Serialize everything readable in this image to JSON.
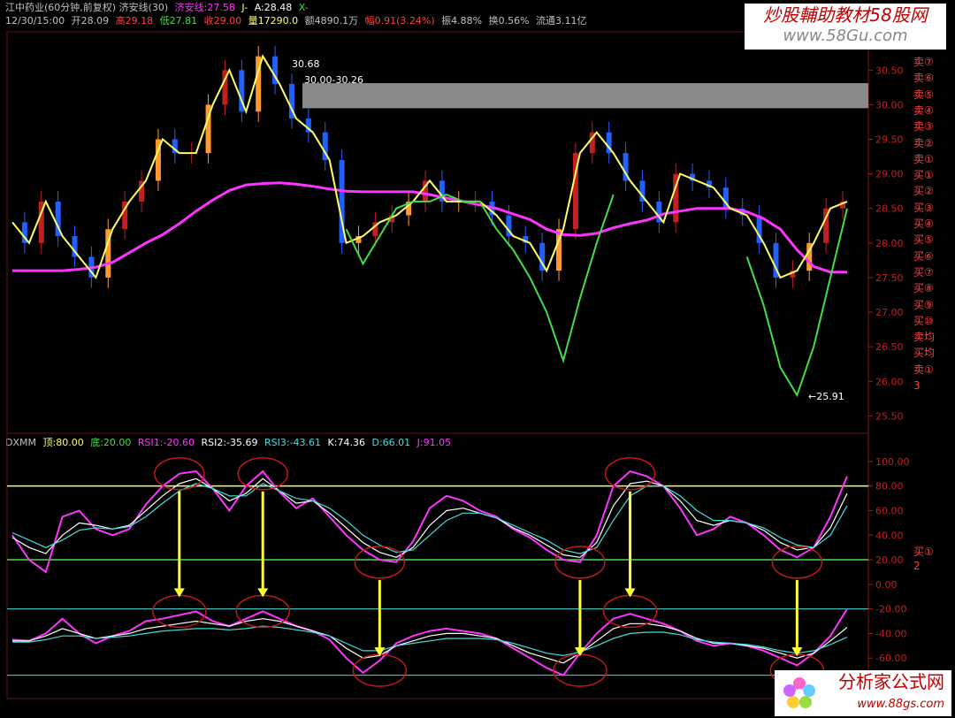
{
  "header": {
    "line1": {
      "title": "江中药业(60分钟,前复权) 济安线(30)",
      "jian_label": "济安线:27.58",
      "j_label": "J-",
      "a_label": "A:28.48",
      "x_label": "X-"
    },
    "line2": {
      "time": "12/30/15:00",
      "open": "开28.09",
      "high": "高29.18",
      "low": "低27.81",
      "close": "收29.00",
      "vol": "量17290.0",
      "amount": "额4890.1万",
      "change": "幅0.91(3.24%)",
      "amp": "振4.88%",
      "turnover": "换0.56%",
      "float": "流通3.11亿"
    }
  },
  "indicator_header": {
    "name": "DXMM",
    "top": "顶:80.00",
    "bottom": "底:20.00",
    "rsi1": "RSI1:-20.60",
    "rsi2": "RSI2:-35.69",
    "rsi3": "RSI3:-43.61",
    "k": "K:74.36",
    "d": "D:66.01",
    "j": "J:91.05"
  },
  "annotations": {
    "high_label": "30.68",
    "zone_label": "30.00-30.26",
    "low_label": "25.91"
  },
  "watermark_top": {
    "title": "炒股輔助教材58股网",
    "url": "www.58Gu.com"
  },
  "watermark_bottom": {
    "title": "分析家公式网",
    "url": "www.88gs.com"
  },
  "right_signals": [
    "卖⑦",
    "卖⑥",
    "卖⑤",
    "卖④",
    "卖③",
    "卖②",
    "卖①",
    "买①",
    "买②",
    "买③",
    "买④",
    "买⑤",
    "买⑥",
    "买⑦",
    "买⑧",
    "买⑨",
    "买⑩",
    "卖均",
    "买均",
    "卖①",
    "3"
  ],
  "right_signals_lower": [
    "买①",
    "2"
  ],
  "colors": {
    "background": "#000000",
    "yellow": "#ffff66",
    "magenta": "#ff33ff",
    "cyan": "#44dddd",
    "green": "#44dd44",
    "red": "#ff2020",
    "up": "#c02020",
    "down": "#2060ff"
  },
  "chart_data": [
    {
      "type": "line",
      "title": "江中药业(60分钟,前复权)",
      "ylim": [
        25.3,
        30.9
      ],
      "yticks": [
        25.5,
        26.0,
        26.5,
        27.0,
        27.5,
        28.0,
        28.5,
        29.0,
        29.5,
        30.0,
        30.5
      ],
      "ytick_labels": [
        "25.50",
        "26.00",
        "26.50",
        "27.00",
        "27.50",
        "28.00",
        "28.50",
        "29.00",
        "29.50",
        "30.00",
        "30.50"
      ],
      "resistance_zone": [
        30.0,
        30.26
      ],
      "series": [
        {
          "name": "济安线",
          "color": "#ff33ff",
          "values": [
            27.6,
            27.6,
            27.6,
            27.6,
            27.62,
            27.65,
            27.72,
            27.86,
            28.0,
            28.12,
            28.28,
            28.46,
            28.62,
            28.76,
            28.84,
            28.86,
            28.87,
            28.85,
            28.82,
            28.78,
            28.75,
            28.74,
            28.74,
            28.74,
            28.74,
            28.7,
            28.65,
            28.6,
            28.55,
            28.5,
            28.42,
            28.34,
            28.2,
            28.12,
            28.11,
            28.14,
            28.22,
            28.28,
            28.33,
            28.42,
            28.46,
            28.5,
            28.5,
            28.5,
            28.45,
            28.35,
            28.2,
            27.9,
            27.66,
            27.58,
            27.58
          ]
        },
        {
          "name": "A",
          "color": "#ffff66",
          "values": [
            28.3,
            28.0,
            28.6,
            28.1,
            27.8,
            27.5,
            28.2,
            28.6,
            28.9,
            29.5,
            29.3,
            29.3,
            30.0,
            30.5,
            29.9,
            30.7,
            30.3,
            29.8,
            29.6,
            29.2,
            28.0,
            28.1,
            28.3,
            28.4,
            28.6,
            28.9,
            28.6,
            28.6,
            28.6,
            28.4,
            28.1,
            28.0,
            27.6,
            28.2,
            29.3,
            29.6,
            29.3,
            28.9,
            28.6,
            28.3,
            29.0,
            28.9,
            28.8,
            28.5,
            28.4,
            28.0,
            27.5,
            27.6,
            28.0,
            28.5,
            28.6
          ]
        },
        {
          "name": "X",
          "color": "#44dd44",
          "values": [
            null,
            null,
            null,
            null,
            null,
            null,
            null,
            null,
            null,
            null,
            null,
            null,
            null,
            null,
            null,
            null,
            null,
            null,
            null,
            null,
            28.2,
            27.7,
            28.1,
            28.5,
            28.6,
            28.6,
            28.7,
            28.6,
            28.6,
            28.2,
            27.9,
            27.5,
            27.0,
            26.3,
            27.2,
            28.0,
            28.7,
            null,
            null,
            null,
            null,
            null,
            null,
            null,
            27.8,
            27.1,
            26.2,
            25.8,
            26.5,
            27.5,
            28.5
          ]
        }
      ]
    },
    {
      "type": "line",
      "title": "DXMM",
      "ylim": [
        -80,
        110
      ],
      "yticks": [
        100,
        80,
        60,
        40,
        20,
        0,
        -20,
        -40,
        -60
      ],
      "ytick_labels": [
        "100.00",
        "80.00",
        "60.00",
        "40.00",
        "20.00",
        "0.00",
        "-20.00",
        "-40.00",
        "-60.00"
      ],
      "reference_lines": [
        {
          "name": "顶",
          "value": 80,
          "color": "#ffff66"
        },
        {
          "name": "底",
          "value": 20,
          "color": "#44dd44"
        }
      ],
      "series": [
        {
          "name": "J",
          "color": "#ff33ff",
          "values": [
            40,
            20,
            10,
            55,
            60,
            45,
            40,
            45,
            65,
            80,
            90,
            92,
            78,
            60,
            80,
            92,
            75,
            62,
            70,
            55,
            40,
            28,
            20,
            18,
            35,
            62,
            72,
            68,
            60,
            55,
            45,
            38,
            28,
            20,
            18,
            40,
            80,
            92,
            88,
            80,
            62,
            40,
            45,
            55,
            50,
            40,
            28,
            22,
            30,
            55,
            88
          ]
        },
        {
          "name": "K",
          "color": "#ffffff",
          "values": [
            38,
            30,
            25,
            40,
            50,
            48,
            45,
            48,
            60,
            72,
            82,
            86,
            78,
            68,
            74,
            86,
            76,
            66,
            68,
            58,
            46,
            34,
            26,
            22,
            30,
            48,
            60,
            62,
            58,
            54,
            46,
            40,
            32,
            24,
            22,
            34,
            64,
            82,
            84,
            80,
            68,
            52,
            48,
            52,
            50,
            44,
            34,
            28,
            30,
            46,
            74
          ]
        },
        {
          "name": "D",
          "color": "#44dddd",
          "values": [
            42,
            36,
            30,
            36,
            44,
            46,
            45,
            47,
            55,
            66,
            76,
            82,
            78,
            72,
            72,
            82,
            76,
            70,
            68,
            62,
            52,
            40,
            32,
            26,
            28,
            40,
            52,
            58,
            58,
            54,
            48,
            42,
            36,
            28,
            25,
            30,
            52,
            72,
            80,
            80,
            72,
            60,
            52,
            52,
            50,
            46,
            38,
            32,
            30,
            40,
            64
          ]
        },
        {
          "name": "RSI1",
          "color": "#ff33ff",
          "values": [
            -45,
            -46,
            -40,
            -28,
            -40,
            -48,
            -42,
            -38,
            -30,
            -28,
            -25,
            -22,
            -30,
            -34,
            -28,
            -22,
            -28,
            -34,
            -38,
            -45,
            -60,
            -72,
            -62,
            -48,
            -42,
            -38,
            -36,
            -38,
            -40,
            -44,
            -52,
            -60,
            -68,
            -74,
            -56,
            -40,
            -28,
            -24,
            -28,
            -32,
            -38,
            -46,
            -50,
            -48,
            -50,
            -54,
            -60,
            -66,
            -56,
            -42,
            -20
          ]
        },
        {
          "name": "RSI2",
          "color": "#ffffff",
          "values": [
            -46,
            -46,
            -42,
            -36,
            -40,
            -44,
            -42,
            -40,
            -36,
            -34,
            -32,
            -30,
            -32,
            -34,
            -30,
            -28,
            -30,
            -34,
            -38,
            -42,
            -52,
            -60,
            -58,
            -50,
            -46,
            -42,
            -40,
            -40,
            -42,
            -44,
            -50,
            -56,
            -60,
            -64,
            -56,
            -46,
            -36,
            -32,
            -32,
            -34,
            -38,
            -44,
            -48,
            -48,
            -50,
            -52,
            -56,
            -60,
            -56,
            -46,
            -35
          ]
        },
        {
          "name": "RSI3",
          "color": "#44dddd",
          "values": [
            -47,
            -47,
            -45,
            -42,
            -42,
            -44,
            -43,
            -42,
            -40,
            -38,
            -37,
            -36,
            -36,
            -37,
            -36,
            -34,
            -35,
            -37,
            -39,
            -42,
            -48,
            -54,
            -54,
            -50,
            -48,
            -46,
            -44,
            -44,
            -44,
            -45,
            -48,
            -52,
            -56,
            -58,
            -55,
            -50,
            -44,
            -40,
            -39,
            -39,
            -41,
            -45,
            -47,
            -48,
            -49,
            -51,
            -54,
            -56,
            -54,
            -49,
            -43
          ]
        }
      ]
    }
  ]
}
